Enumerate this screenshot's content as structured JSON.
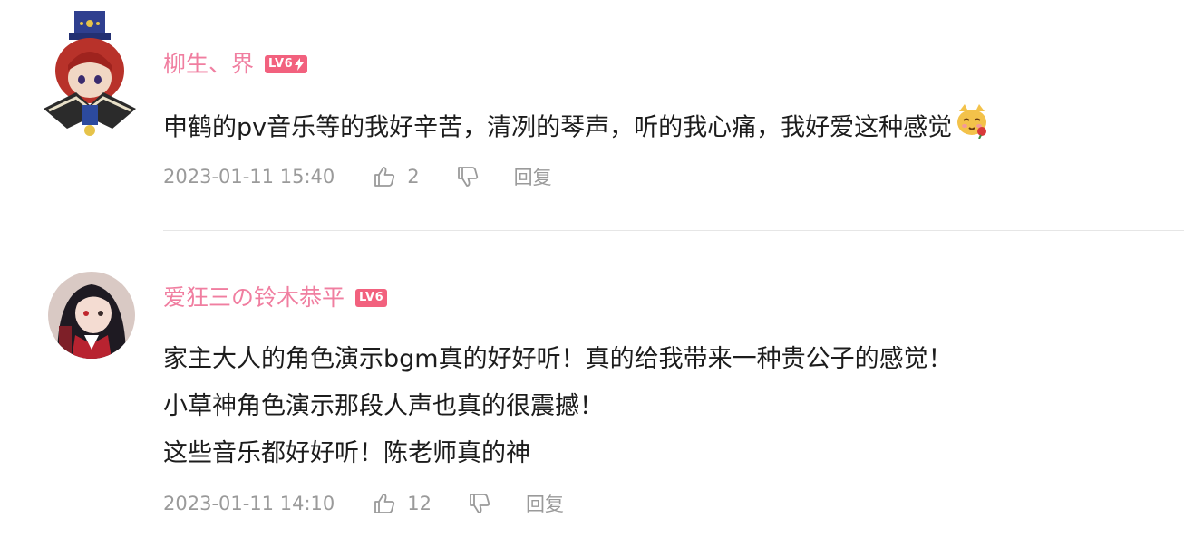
{
  "colors": {
    "username": "#f07ea0",
    "badge": "#f2617e",
    "meta_text": "#9a9a9a",
    "content_text": "#1c1c1c"
  },
  "comments": [
    {
      "username": "柳生、界",
      "level": "LV6",
      "content_lines": [
        "申鹤的pv音乐等的我好辛苦，清冽的琴声，听的我心痛，我好爱这种感觉"
      ],
      "emoji": "cat-emoji-icon",
      "timestamp": "2023-01-11 15:40",
      "likes": "2",
      "reply_label": "回复"
    },
    {
      "username": "爱狂三の铃木恭平",
      "level": "LV6",
      "content_lines": [
        "家主大人的角色演示bgm真的好好听！真的给我带来一种贵公子的感觉！",
        "小草神角色演示那段人声也真的很震撼！",
        "这些音乐都好好听！陈老师真的神"
      ],
      "timestamp": "2023-01-11 14:10",
      "likes": "12",
      "reply_label": "回复"
    }
  ]
}
